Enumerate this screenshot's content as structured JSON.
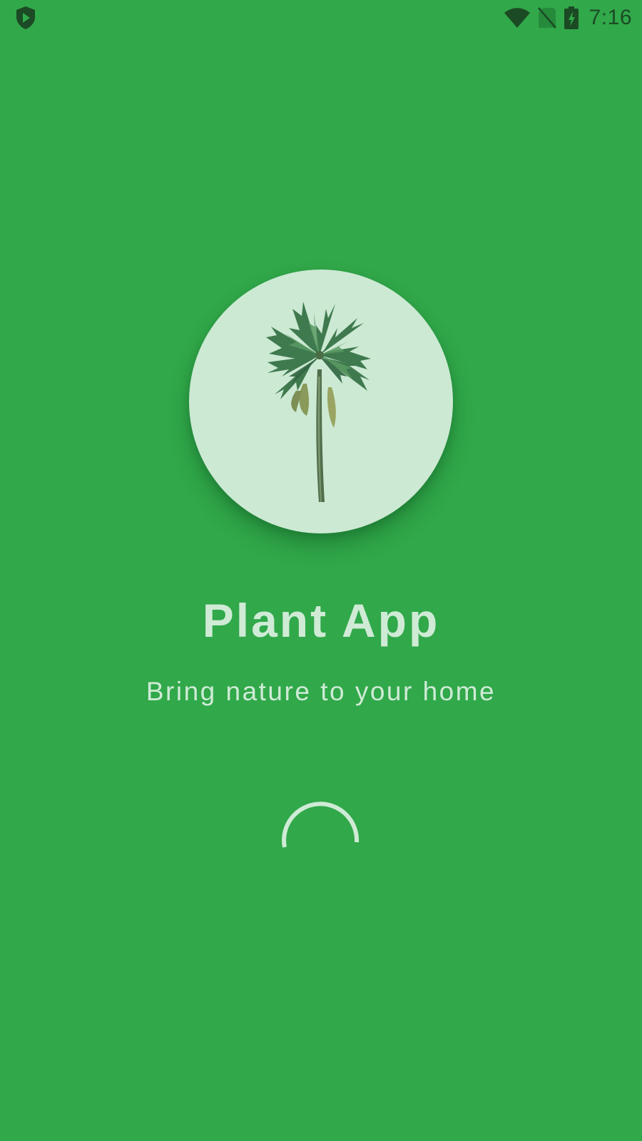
{
  "status_bar": {
    "time": "7:16",
    "left_icon": "play-shield-icon",
    "icons": [
      "wifi-icon",
      "no-sim-icon",
      "battery-charging-icon"
    ]
  },
  "splash": {
    "image": "palm-tree-icon",
    "title": "Plant App",
    "tagline": "Bring nature to your home",
    "spinner": "loading-spinner"
  },
  "colors": {
    "background": "#31a84a",
    "circle": "#cce9d3",
    "text": "#cfebd6",
    "status_icons": "#1b4a24"
  }
}
